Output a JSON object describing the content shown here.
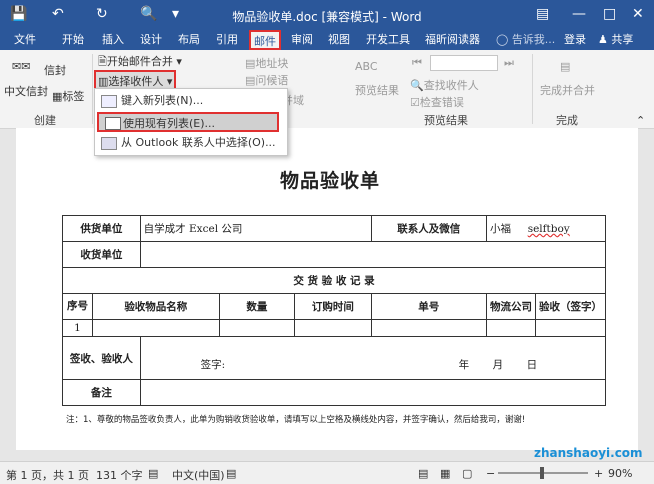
{
  "titlebar": {
    "title": "物品验收单.doc [兼容模式] - Word",
    "save_icon": "save-icon",
    "undo_icon": "undo-icon",
    "redo_icon": "redo-icon"
  },
  "tabs": [
    "文件",
    "开始",
    "插入",
    "设计",
    "布局",
    "引用",
    "邮件",
    "审阅",
    "视图",
    "开发工具",
    "福昕阅读器"
  ],
  "active_tab": "邮件",
  "tellme": "告诉我...",
  "login": "登录",
  "share": "共享",
  "ribbon": {
    "envelope": "信封",
    "chinese_envelope": "中文信封",
    "labels": "标签",
    "group_create": "创建",
    "start_merge": "开始邮件合并",
    "select_recipients": "选择收件人",
    "address_block": "地址块",
    "greeting_line": "问候语",
    "insert_field": "并域",
    "preview": "预览结果",
    "find_recipient": "查找收件人",
    "check_errors": "检查错误",
    "group_preview": "预览结果",
    "finish_merge": "完成并合并",
    "group_finish": "完成"
  },
  "menu": {
    "items": [
      "键入新列表(N)...",
      "使用现有列表(E)...",
      "从 Outlook 联系人中选择(O)..."
    ]
  },
  "doc": {
    "title": "物品验收单",
    "supplier_label": "供货单位",
    "supplier_value": "自学成才 Excel 公司",
    "contact_label": "联系人及微信",
    "contact_name": "小福",
    "contact_wechat": "selftboy",
    "receiver_label": "收货单位",
    "record_header": "交 货 验 收 记 录",
    "columns": [
      "序号",
      "验收物品名称",
      "数量",
      "订购时间",
      "单号",
      "物流公司",
      "验收（签字）"
    ],
    "row_number": "1",
    "signer_label": "签收、验收人",
    "sign_text": "签字:",
    "year": "年",
    "month": "月",
    "day": "日",
    "remark_label": "备注",
    "note": "注：1、尊敬的物品签收负责人，此单为购销收货验收单，请填写以上空格及横线处内容，并签字确认，然后给我司，谢谢!"
  },
  "status": {
    "page": "第 1 页，共 1 页",
    "words": "131 个字",
    "language": "中文(中国)",
    "zoom": "90%"
  },
  "watermark": "zhanshaoyi.com",
  "colors": {
    "brand": "#2b579a",
    "highlight": "#e03030"
  }
}
